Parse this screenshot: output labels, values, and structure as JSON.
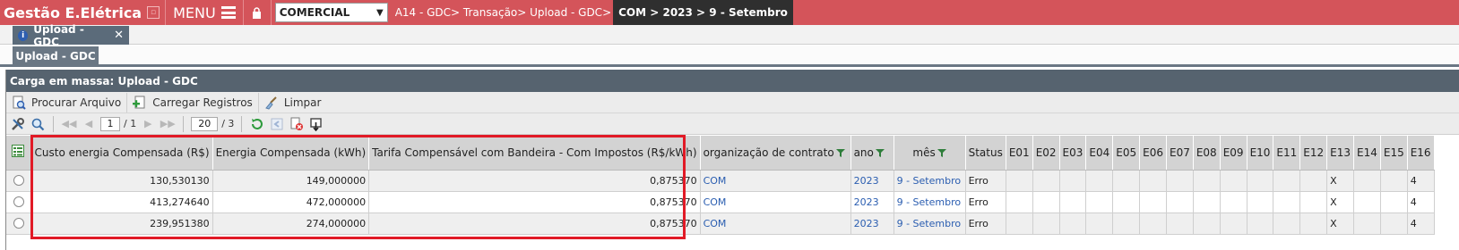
{
  "topbar": {
    "app_title": "Gestão E.Elétrica",
    "menu_label": "MENU",
    "company_select": "COMERCIAL",
    "breadcrumb": "A14 - GDC> Transação> Upload - GDC>",
    "breadcrumb_path": "COM > 2023 > 9 - Setembro"
  },
  "tabs": {
    "main_tab": "Upload - GDC",
    "sub_tab": "Upload - GDC"
  },
  "panel": {
    "title": "Carga em massa: Upload - GDC",
    "toolbar": {
      "browse": "Procurar Arquivo",
      "load": "Carregar Registros",
      "clear": "Limpar"
    },
    "pager": {
      "page": "1",
      "pages": "/ 1",
      "page_size": "20",
      "total": "/ 3"
    }
  },
  "grid": {
    "columns": [
      "Custo energia Compensada (R$)",
      "Energia Compensada (kWh)",
      "Tarifa Compensável com Bandeira - Com Impostos (R$/kWh)",
      "organização de contrato",
      "ano",
      "mês",
      "Status",
      "E01",
      "E02",
      "E03",
      "E04",
      "E05",
      "E06",
      "E07",
      "E08",
      "E09",
      "E10",
      "E11",
      "E12",
      "E13",
      "E14",
      "E15",
      "E16"
    ],
    "rows": [
      {
        "custo": "130,530130",
        "energia": "149,000000",
        "tarifa": "0,875370",
        "org": "COM",
        "ano": "2023",
        "mes": "9 - Setembro",
        "status": "Erro",
        "e13": "X",
        "e16": "4"
      },
      {
        "custo": "413,274640",
        "energia": "472,000000",
        "tarifa": "0,875370",
        "org": "COM",
        "ano": "2023",
        "mes": "9 - Setembro",
        "status": "Erro",
        "e13": "X",
        "e16": "4"
      },
      {
        "custo": "239,951380",
        "energia": "274,000000",
        "tarifa": "0,875370",
        "org": "COM",
        "ano": "2023",
        "mes": "9 - Setembro",
        "status": "Erro",
        "e13": "X",
        "e16": "4"
      }
    ]
  },
  "colors": {
    "topbar": "#d4545a",
    "panel_header": "#56636f",
    "highlight": "#e11a26",
    "link": "#2a5db0"
  }
}
